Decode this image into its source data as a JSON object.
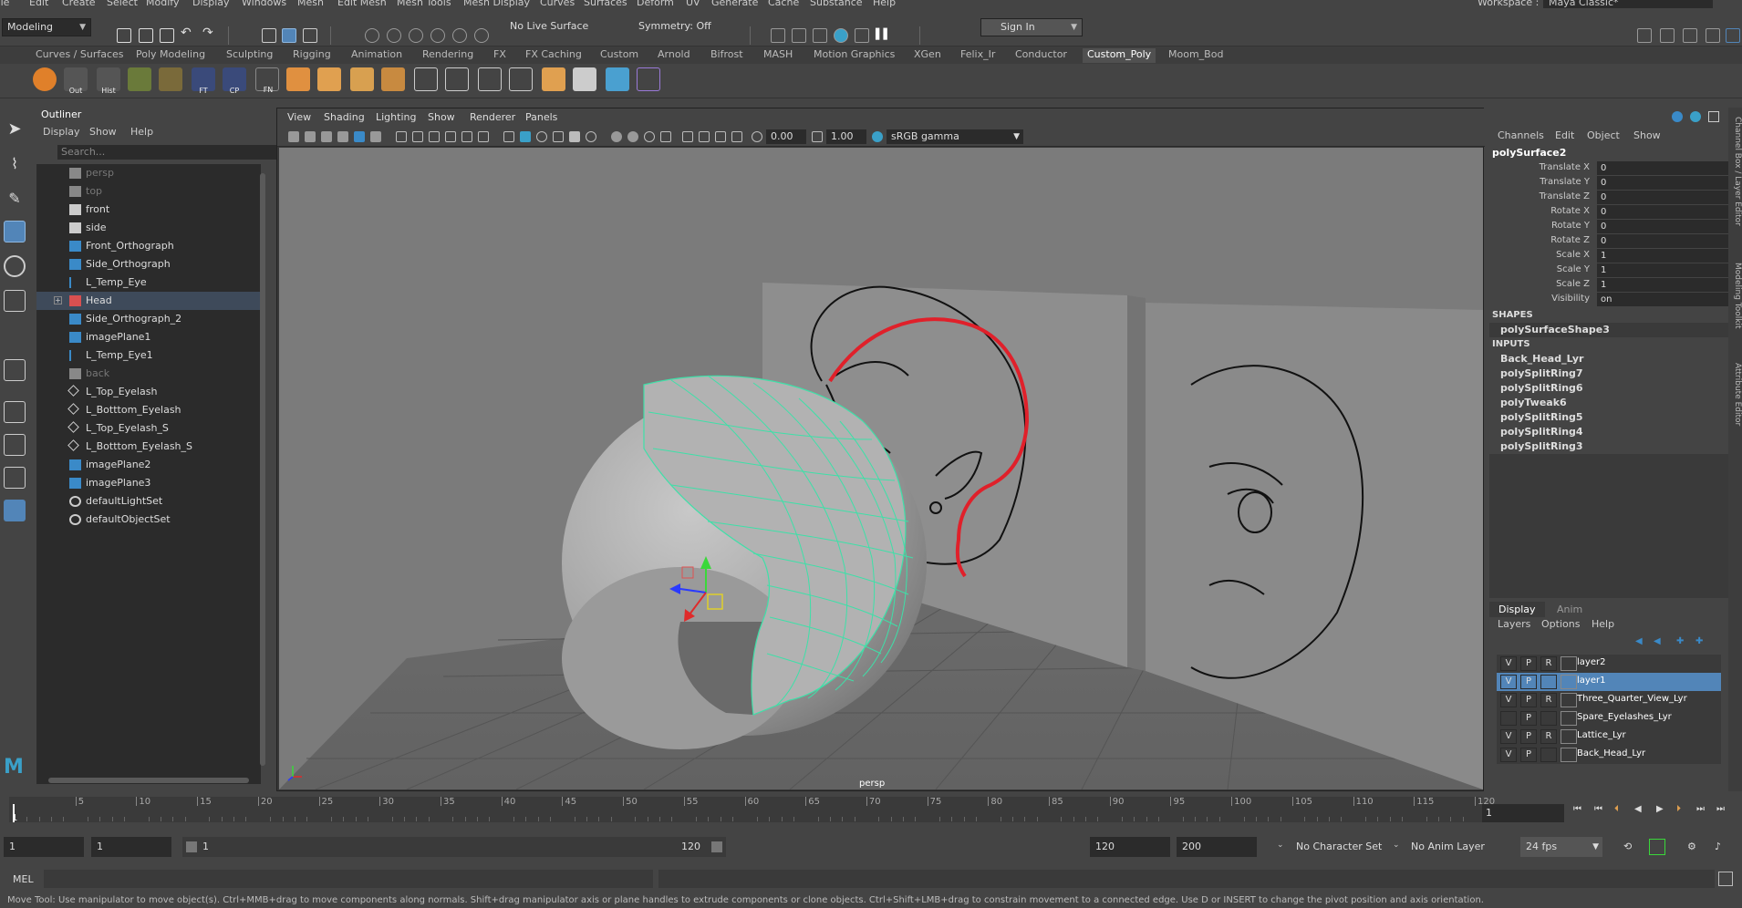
{
  "menubar": {
    "items": [
      "File",
      "Edit",
      "Create",
      "Select",
      "Modify",
      "Display",
      "Windows",
      "Mesh",
      "Edit Mesh",
      "Mesh Tools",
      "Mesh Display",
      "Curves",
      "Surfaces",
      "Deform",
      "UV",
      "Generate",
      "Cache",
      "Substance",
      "Help"
    ],
    "workspace_label": "Workspace :",
    "workspace_value": "Maya Classic*"
  },
  "status": {
    "mode": "Modeling",
    "live_surface": "No Live Surface",
    "symmetry": "Symmetry: Off",
    "sign_in": "Sign In"
  },
  "shelf_tabs": [
    "Curves / Surfaces",
    "Poly Modeling",
    "Sculpting",
    "Rigging",
    "Animation",
    "Rendering",
    "FX",
    "FX Caching",
    "Custom",
    "Arnold",
    "Bifrost",
    "MASH",
    "Motion Graphics",
    "XGen",
    "Felix_Ir",
    "Conductor",
    "Custom_Poly",
    "Moom_Bod"
  ],
  "shelf_active": "Custom_Poly",
  "shelf_icons": {
    "out": "Out",
    "hist": "Hist",
    "ft": "FT",
    "cp": "CP",
    "fn": "FN"
  },
  "outliner": {
    "title": "Outliner",
    "menu": [
      "Display",
      "Show",
      "Help"
    ],
    "search_placeholder": "Search...",
    "items": [
      {
        "label": "persp",
        "icon": "camera-icon",
        "dim": true
      },
      {
        "label": "top",
        "icon": "camera-icon",
        "dim": true
      },
      {
        "label": "front",
        "icon": "camera-icon",
        "dim": false
      },
      {
        "label": "side",
        "icon": "camera-icon",
        "dim": false
      },
      {
        "label": "Front_Orthograph",
        "icon": "image-plane-icon",
        "dim": false
      },
      {
        "label": "Side_Orthograph",
        "icon": "image-plane-icon",
        "dim": false
      },
      {
        "label": "L_Temp_Eye",
        "icon": "curve-icon",
        "dim": false
      },
      {
        "label": "Head",
        "icon": "mesh-icon",
        "dim": false,
        "selected": true,
        "expand": true
      },
      {
        "label": "Side_Orthograph_2",
        "icon": "image-plane-icon",
        "dim": false
      },
      {
        "label": "imagePlane1",
        "icon": "image-plane-icon",
        "dim": false
      },
      {
        "label": "L_Temp_Eye1",
        "icon": "curve-icon",
        "dim": false
      },
      {
        "label": "back",
        "icon": "camera-icon",
        "dim": true
      },
      {
        "label": "L_Top_Eyelash",
        "icon": "transform-icon",
        "dim": false
      },
      {
        "label": "L_Botttom_Eyelash",
        "icon": "transform-icon",
        "dim": false
      },
      {
        "label": "L_Top_Eyelash_S",
        "icon": "transform-icon",
        "dim": false
      },
      {
        "label": "L_Botttom_Eyelash_S",
        "icon": "transform-icon",
        "dim": false
      },
      {
        "label": "imagePlane2",
        "icon": "image-plane-icon",
        "dim": false
      },
      {
        "label": "imagePlane3",
        "icon": "image-plane-icon",
        "dim": false
      },
      {
        "label": "defaultLightSet",
        "icon": "set-icon",
        "dim": false
      },
      {
        "label": "defaultObjectSet",
        "icon": "set-icon",
        "dim": false
      }
    ]
  },
  "viewport": {
    "menu": [
      "View",
      "Shading",
      "Lighting",
      "Show",
      "Renderer",
      "Panels"
    ],
    "exposure": "0.00",
    "gamma": "1.00",
    "color_space": "sRGB gamma",
    "camera_label": "persp"
  },
  "channelbox": {
    "menu": [
      "Channels",
      "Edit",
      "Object",
      "Show"
    ],
    "object": "polySurface2",
    "channels": [
      {
        "name": "Translate X",
        "value": "0"
      },
      {
        "name": "Translate Y",
        "value": "0"
      },
      {
        "name": "Translate Z",
        "value": "0"
      },
      {
        "name": "Rotate X",
        "value": "0"
      },
      {
        "name": "Rotate Y",
        "value": "0"
      },
      {
        "name": "Rotate Z",
        "value": "0"
      },
      {
        "name": "Scale X",
        "value": "1"
      },
      {
        "name": "Scale Y",
        "value": "1"
      },
      {
        "name": "Scale Z",
        "value": "1"
      },
      {
        "name": "Visibility",
        "value": "on"
      }
    ],
    "shapes_header": "SHAPES",
    "shape": "polySurfaceShape3",
    "inputs_header": "INPUTS",
    "inputs": [
      "Back_Head_Lyr",
      "polySplitRing7",
      "polySplitRing6",
      "polyTweak6",
      "polySplitRing5",
      "polySplitRing4",
      "polySplitRing3"
    ]
  },
  "layers": {
    "tabs": [
      "Display",
      "Anim"
    ],
    "menu": [
      "Layers",
      "Options",
      "Help"
    ],
    "rows": [
      {
        "v": "V",
        "p": "P",
        "r": "R",
        "name": "layer2",
        "selected": false
      },
      {
        "v": "V",
        "p": "P",
        "r": "",
        "name": "layer1",
        "selected": true
      },
      {
        "v": "V",
        "p": "P",
        "r": "R",
        "name": "Three_Quarter_View_Lyr",
        "selected": false
      },
      {
        "v": "",
        "p": "P",
        "r": "",
        "name": "Spare_Eyelashes_Lyr",
        "selected": false
      },
      {
        "v": "V",
        "p": "P",
        "r": "R",
        "name": "Lattice_Lyr",
        "selected": false
      },
      {
        "v": "V",
        "p": "P",
        "r": "",
        "name": "Back_Head_Lyr",
        "selected": false
      }
    ]
  },
  "side_tabs": [
    "Channel Box / Layer Editor",
    "Modeling Toolkit",
    "Attribute Editor"
  ],
  "timeline": {
    "ticks": [
      "5",
      "10",
      "15",
      "20",
      "25",
      "30",
      "35",
      "40",
      "45",
      "50",
      "55",
      "60",
      "65",
      "70",
      "75",
      "80",
      "85",
      "90",
      "95",
      "100",
      "105",
      "110",
      "115",
      "120"
    ],
    "start_marker": "1",
    "current_frame": "1"
  },
  "range": {
    "start": "1",
    "anim_start": "1",
    "slider_start": "1",
    "slider_end": "120",
    "end": "120",
    "anim_end": "200",
    "char_set": "No Character Set",
    "anim_layer": "No Anim Layer",
    "fps": "24 fps"
  },
  "cmdline": {
    "label": "MEL"
  },
  "helpline": "Move Tool: Use manipulator to move object(s). Ctrl+MMB+drag to move components along normals. Shift+drag manipulator axis or plane handles to extrude components or clone objects. Ctrl+Shift+LMB+drag to constrain movement to a connected edge. Use D or INSERT to change the pivot position and axis orientation."
}
